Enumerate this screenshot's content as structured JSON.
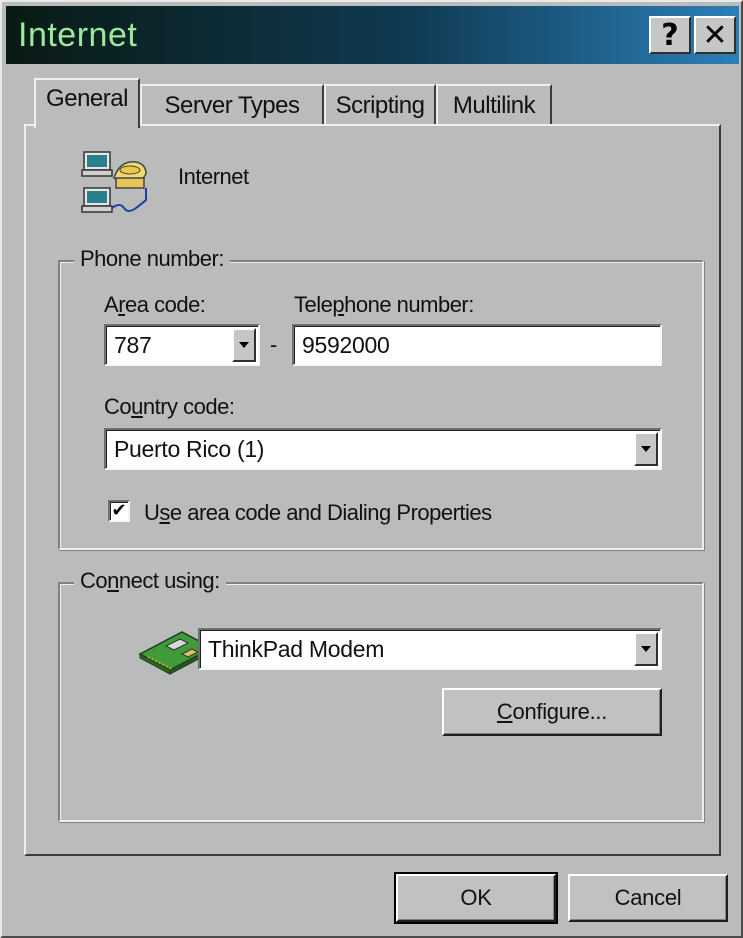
{
  "window": {
    "title": "Internet",
    "help_label": "?",
    "close_label": "✕"
  },
  "tabs": [
    {
      "label": "General",
      "active": true
    },
    {
      "label": "Server Types",
      "active": false
    },
    {
      "label": "Scripting",
      "active": false
    },
    {
      "label": "Multilink",
      "active": false
    }
  ],
  "general": {
    "connection_icon": "dialup-connection-icon",
    "connection_name": "Internet",
    "phone_group": {
      "legend": "Phone number:",
      "area_code_label_pre": "A",
      "area_code_label_key": "r",
      "area_code_label_post": "ea code:",
      "area_code_value": "787",
      "separator": "-",
      "telephone_label_pre": "Tele",
      "telephone_label_key": "p",
      "telephone_label_post": "hone number:",
      "telephone_value": "9592000",
      "country_label_pre": "Co",
      "country_label_key": "u",
      "country_label_post": "ntry code:",
      "country_value": "Puerto Rico (1)",
      "checkbox_checked": true,
      "checkbox_mark": "✔",
      "checkbox_label_pre": "U",
      "checkbox_label_key": "s",
      "checkbox_label_post": "e area code and Dialing Properties"
    },
    "connect_group": {
      "legend_pre": "Co",
      "legend_key": "n",
      "legend_post": "nect using:",
      "modem_icon": "modem-card-icon",
      "device_value": "ThinkPad Modem",
      "configure_key": "C",
      "configure_rest": "onfigure..."
    }
  },
  "footer": {
    "ok_label": "OK",
    "cancel_label": "Cancel"
  },
  "colors": {
    "face": "#b9bcbb",
    "title_text": "#9ce89c",
    "title_start": "#0a1a14",
    "title_end": "#2c7fb8"
  }
}
